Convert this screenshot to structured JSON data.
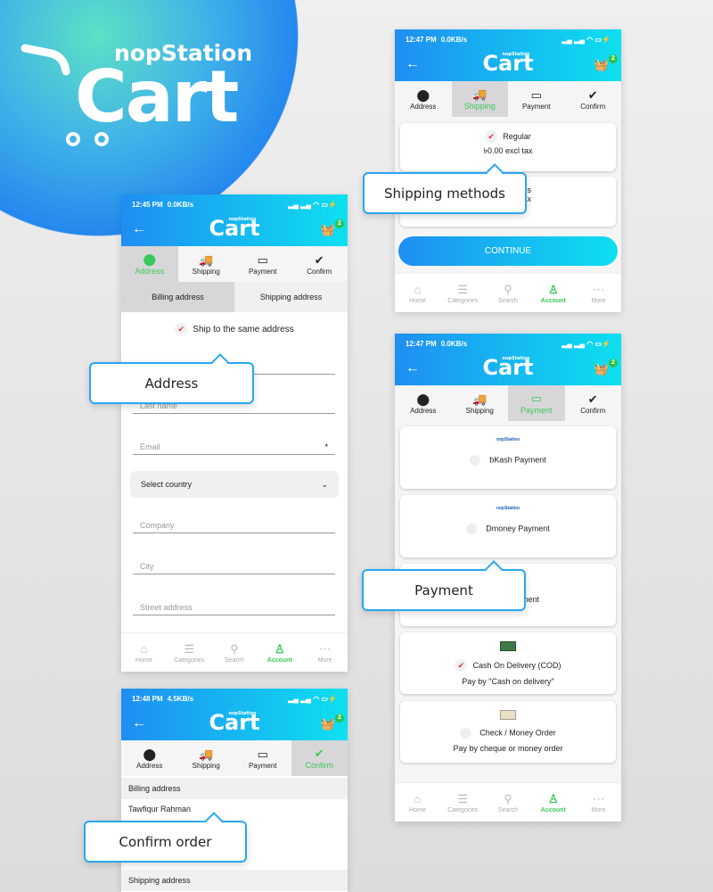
{
  "brand": {
    "small": "nopStation",
    "big": "Cart"
  },
  "common": {
    "steps": [
      {
        "label": "Address",
        "icon": "map-pin-icon",
        "g": "⬤"
      },
      {
        "label": "Shipping",
        "icon": "truck-icon",
        "g": "🚚"
      },
      {
        "label": "Payment",
        "icon": "credit-card-icon",
        "g": "▭"
      },
      {
        "label": "Confirm",
        "icon": "check-circle-icon",
        "g": "✔"
      }
    ],
    "nav": [
      {
        "label": "Home",
        "icon": "home-icon",
        "g": "⌂"
      },
      {
        "label": "Categories",
        "icon": "menu-icon",
        "g": "☰"
      },
      {
        "label": "Search",
        "icon": "search-icon",
        "g": "⚲"
      },
      {
        "label": "Account",
        "icon": "user-icon",
        "g": "♙"
      },
      {
        "label": "More",
        "icon": "more-icon",
        "g": "⋯"
      }
    ],
    "logo": "Cart",
    "logo_small": "nopStation",
    "cart_count": "2",
    "active_color": "#3cc85a"
  },
  "phones": {
    "address": {
      "time": "12:45 PM",
      "speed": "0.0KB/s",
      "active_step": 0,
      "subtabs": [
        "Billing address",
        "Shipping address"
      ],
      "same_address": "Ship to the same address",
      "fields": [
        "Last name",
        "Email",
        "Company",
        "City",
        "Street address"
      ],
      "email_required": "*",
      "country": "Select country"
    },
    "shipping": {
      "time": "12:47 PM",
      "speed": "0.0KB/s",
      "active_step": 1,
      "method": "Regular",
      "price": "৳0.00 excl tax",
      "method2_partial": "s",
      "price2_partial": "ax",
      "continue": "CONTINUE"
    },
    "payment": {
      "time": "12:47 PM",
      "speed": "0.0KB/s",
      "active_step": 2,
      "methods": [
        {
          "logo": "nopStation",
          "name": "bKash Payment"
        },
        {
          "logo": "nopStation",
          "name": "Dmoney Payment"
        },
        {
          "name": "ment"
        },
        {
          "name": "Cash On Delivery (COD)",
          "desc": "Pay by \"Cash on delivery\"",
          "selected": true
        },
        {
          "name": "Check / Money Order",
          "desc": "Pay by cheque or money order"
        }
      ]
    },
    "confirm": {
      "time": "12:48 PM",
      "speed": "4.5KB/s",
      "active_step": 3,
      "billing": "Billing address",
      "name": "Tawfiqur Rahman",
      "shipping": "Shipping address"
    }
  },
  "callouts": {
    "shipping": "Shipping methods",
    "address": "Address",
    "payment": "Payment",
    "confirm": "Confirm order"
  }
}
